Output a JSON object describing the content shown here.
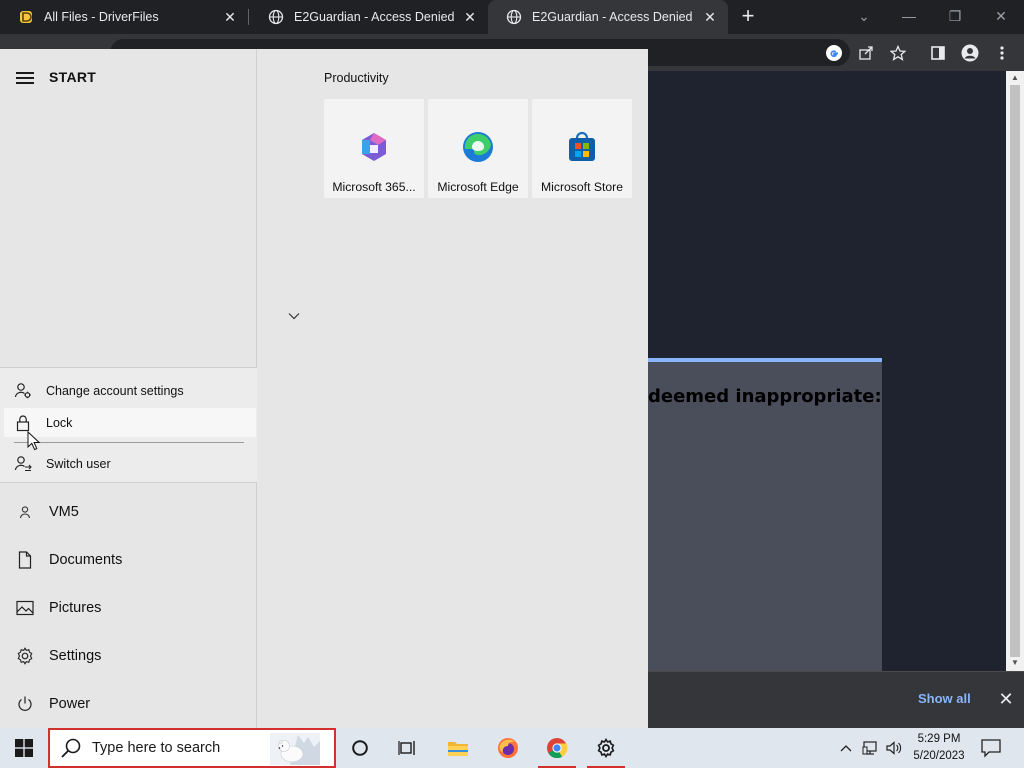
{
  "browser": {
    "tabs": [
      {
        "title": "All Files - DriverFiles",
        "favicon": "driverfiles-icon"
      },
      {
        "title": "E2Guardian - Access Denied",
        "favicon": "globe-icon"
      },
      {
        "title": "E2Guardian - Access Denied",
        "favicon": "globe-icon",
        "active": true
      }
    ],
    "new_tab_symbol": "+",
    "close_symbol": "✕"
  },
  "page": {
    "dialog_text": "deemed inappropriate:",
    "accent": "#8ab4f8"
  },
  "downloads_bar": {
    "show_all": "Show all"
  },
  "start_menu": {
    "title": "START",
    "account_menu": {
      "items": [
        {
          "label": "Change account settings",
          "icon": "person-gear-icon"
        },
        {
          "label": "Lock",
          "icon": "lock-icon"
        },
        {
          "label": "Switch user",
          "icon": "switch-user-icon"
        }
      ]
    },
    "nav": [
      {
        "label": "VM5",
        "icon": "user-icon"
      },
      {
        "label": "Documents",
        "icon": "document-icon"
      },
      {
        "label": "Pictures",
        "icon": "picture-icon"
      },
      {
        "label": "Settings",
        "icon": "gear-icon"
      },
      {
        "label": "Power",
        "icon": "power-icon"
      }
    ],
    "group": {
      "title": "Productivity",
      "tiles": [
        {
          "label": "Microsoft 365...",
          "icon": "microsoft-365-icon"
        },
        {
          "label": "Microsoft Edge",
          "icon": "edge-icon"
        },
        {
          "label": "Microsoft Store",
          "icon": "store-icon"
        }
      ]
    }
  },
  "taskbar": {
    "search_placeholder": "Type here to search",
    "apps": [
      "cortana-icon",
      "task-view-icon",
      "file-explorer-icon",
      "firefox-icon",
      "chrome-icon",
      "settings-icon"
    ],
    "time": "5:29 PM",
    "date": "5/20/2023",
    "tray_chevron": "^"
  }
}
